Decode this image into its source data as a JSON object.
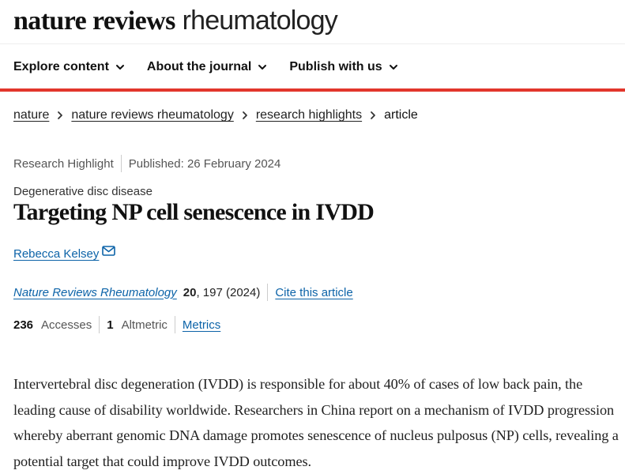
{
  "brand": {
    "bold": "nature reviews",
    "light": "rheumatology"
  },
  "nav": {
    "items": [
      {
        "label": "Explore content"
      },
      {
        "label": "About the journal"
      },
      {
        "label": "Publish with us"
      }
    ]
  },
  "breadcrumb": {
    "items": [
      {
        "label": "nature"
      },
      {
        "label": "nature reviews rheumatology"
      },
      {
        "label": "research highlights"
      }
    ],
    "current": "article"
  },
  "article": {
    "type": "Research Highlight",
    "published": "Published: 26 February 2024",
    "subject": "Degenerative disc disease",
    "title": "Targeting NP cell senescence in IVDD",
    "author": "Rebecca Kelsey",
    "citation": {
      "journal": "Nature Reviews Rheumatology",
      "volume": "20",
      "pages": ", 197 (2024)",
      "cite_label": "Cite this article"
    },
    "metrics": {
      "accesses_value": "236",
      "accesses_label": "Accesses",
      "altmetric_value": "1",
      "altmetric_label": "Altmetric",
      "metrics_link": "Metrics"
    },
    "abstract": "Intervertebral disc degeneration (IVDD) is responsible for about 40% of cases of low back pain, the leading cause of disability worldwide. Researchers in China report on a mechanism of IVDD progression whereby aberrant genomic DNA damage promotes senescence of nucleus pulposus (NP) cells, revealing a potential target that could improve IVDD outcomes."
  },
  "colors": {
    "accent_red": "#e2362c",
    "link_blue": "#0c63a8"
  },
  "icons": {
    "chevron": "chevron-down-icon",
    "breadcrumb_sep": "chevron-right-icon",
    "mail": "mail-icon"
  }
}
